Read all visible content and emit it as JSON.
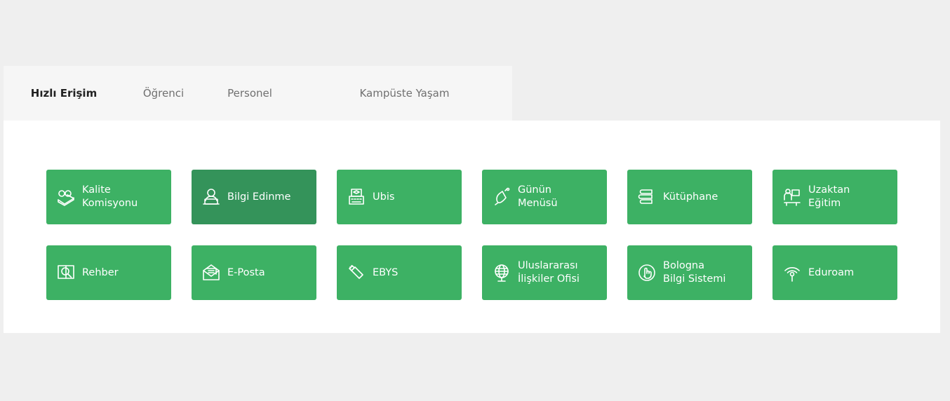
{
  "tabs": [
    {
      "label": "Hızlı Erişim",
      "active": true
    },
    {
      "label": "Öğrenci",
      "active": false
    },
    {
      "label": "Personel",
      "active": false
    },
    {
      "label": "Kampüste Yaşam",
      "active": false
    }
  ],
  "tiles": [
    {
      "label": "Kalite\nKomisyonu",
      "icon": "glasses-book-icon"
    },
    {
      "label": "Bilgi Edinme",
      "icon": "user-laptop-icon"
    },
    {
      "label": "Ubis",
      "icon": "typewriter-graduation-icon"
    },
    {
      "label": "Günün\nMenüsü",
      "icon": "bell-icon"
    },
    {
      "label": "Kütüphane",
      "icon": "book-stack-icon"
    },
    {
      "label": "Uzaktan\nEğitim",
      "icon": "remote-learning-icon"
    },
    {
      "label": "Rehber",
      "icon": "search-book-icon"
    },
    {
      "label": "E-Posta",
      "icon": "envelope-icon"
    },
    {
      "label": "EBYS",
      "icon": "usb-drive-icon"
    },
    {
      "label": "Uluslararası\nİlişkiler Ofisi",
      "icon": "globe-icon"
    },
    {
      "label": "Bologna\nBilgi Sistemi",
      "icon": "hand-pointer-icon"
    },
    {
      "label": "Eduroam",
      "icon": "wifi-antenna-icon"
    }
  ],
  "colors": {
    "tile": "#3db164",
    "tile_hover": "#34935a",
    "background": "#efefef",
    "tab_bar": "#f6f6f6"
  }
}
